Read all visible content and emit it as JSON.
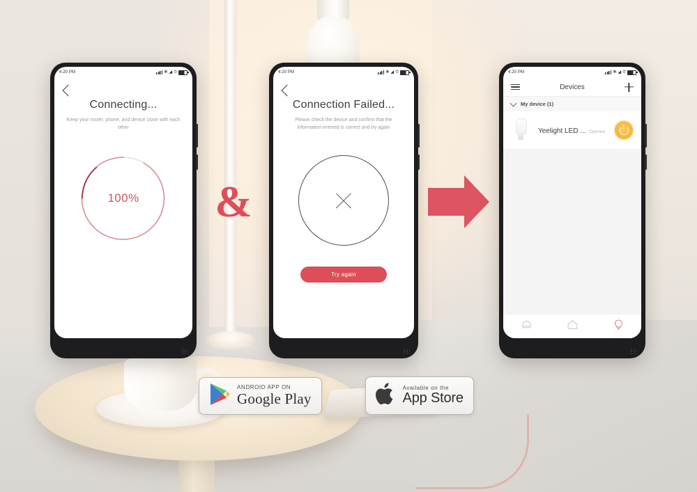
{
  "scene": {
    "background_objects": [
      "pendant-lamp",
      "floor-lamp-pole",
      "round-table",
      "coffee-cup",
      "saucer",
      "tablet-on-table",
      "charging-cable"
    ]
  },
  "colors": {
    "accent_red": "#dd4e59",
    "progress_red": "#c9565f",
    "power_amber": "#f7ba3e",
    "text_dark": "#3a3a3a",
    "text_muted": "#9a9a9a",
    "background_beige": "#f6ece1"
  },
  "phones": [
    {
      "id": "phone-connecting",
      "status_bar": {
        "time": "4:20 PM",
        "icons": [
          "signal-icon",
          "bluetooth-icon",
          "wifi-icon",
          "alarm-icon",
          "battery-icon"
        ]
      },
      "back_label": "Back",
      "title": "Connecting...",
      "subtitle": "Keep your router, phone, and device close with each other",
      "progress": {
        "value": 100,
        "label": "100%"
      }
    },
    {
      "id": "phone-failed",
      "status_bar": {
        "time": "4:20 PM",
        "icons": [
          "signal-icon",
          "bluetooth-icon",
          "wifi-icon",
          "alarm-icon",
          "battery-icon"
        ]
      },
      "back_label": "Back",
      "title": "Connection Failed...",
      "subtitle": "Please check the device and confirm that the information entered is correct and try again",
      "error_icon": "x-circle-icon",
      "button_label": "Try again"
    },
    {
      "id": "phone-devices",
      "status_bar": {
        "time": "4:20 PM",
        "icons": [
          "signal-icon",
          "bluetooth-icon",
          "wifi-icon",
          "alarm-icon",
          "battery-icon"
        ]
      },
      "appbar": {
        "menu_icon": "hamburger-icon",
        "title": "Devices",
        "add_icon": "plus-icon"
      },
      "group": {
        "chevron": "chevron-down-icon",
        "label": "My device (1)"
      },
      "device": {
        "thumb_icon": "bulb-icon",
        "name": "Yeelight LED ...",
        "status": "Opened",
        "power_icon": "power-icon"
      },
      "bottom_nav": [
        {
          "icon": "lamp-icon",
          "active": false
        },
        {
          "icon": "home-icon",
          "active": false
        },
        {
          "icon": "bulb-icon",
          "active": true
        }
      ]
    }
  ],
  "connectors": {
    "ampersand": "&",
    "arrow": "arrow-right-icon"
  },
  "store_badges": [
    {
      "id": "google-play",
      "icon": "google-play-icon",
      "small_text": "ANDROID APP ON",
      "big_text": "Google Play"
    },
    {
      "id": "app-store",
      "icon": "apple-icon",
      "small_text": "Available on the",
      "big_text": "App Store"
    }
  ]
}
